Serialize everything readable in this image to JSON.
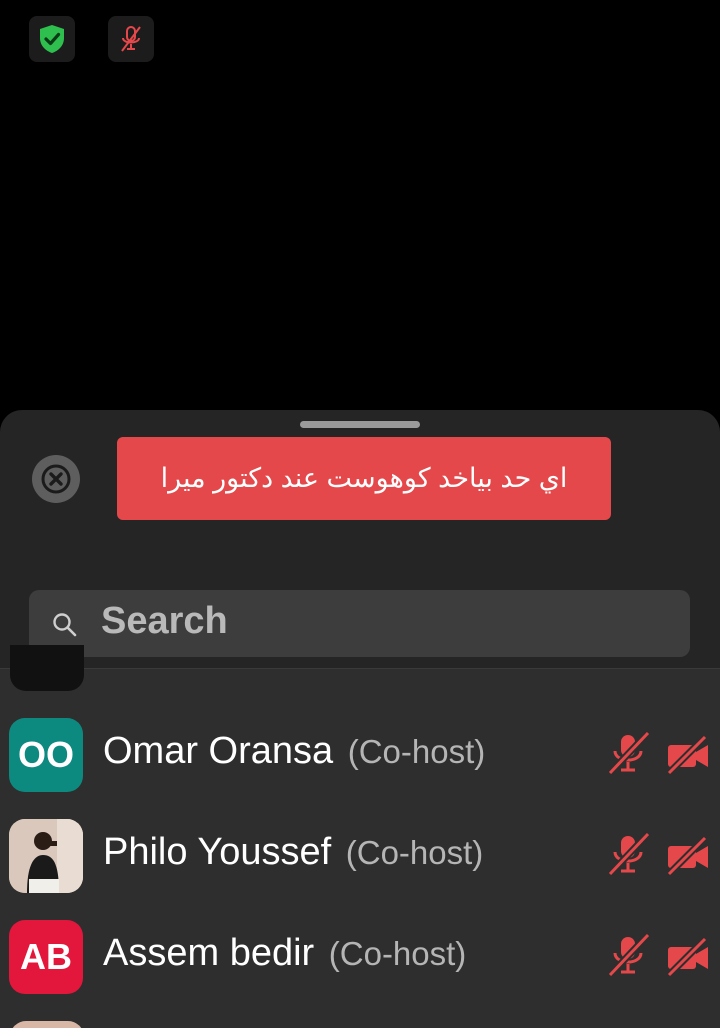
{
  "toast": {
    "message": "اي حد بياخد كوهوست عند دكتور ميرا"
  },
  "search": {
    "placeholder": "Search"
  },
  "participants": [
    {
      "initials": "OO",
      "name": "Omar Oransa",
      "role": "(Co-host)",
      "avatar_color": "#0d8a80"
    },
    {
      "initials": "",
      "name": "Philo Youssef",
      "role": "(Co-host)",
      "avatar_color": "#d8c6b8"
    },
    {
      "initials": "AB",
      "name": "Assem bedir",
      "role": "(Co-host)",
      "avatar_color": "#e3163c"
    }
  ],
  "colors": {
    "muted": "#e5484a",
    "sheet": "#252525",
    "list": "#2e2e2e",
    "shield": "#2fbf4f"
  }
}
